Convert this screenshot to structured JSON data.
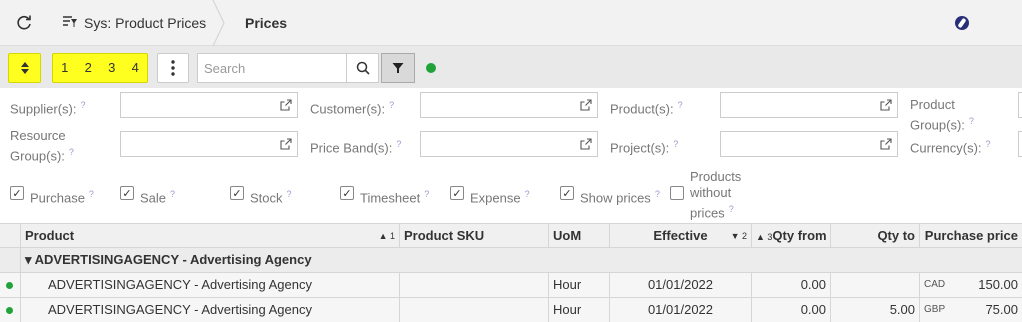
{
  "header": {
    "crumb1": "Sys: Product Prices",
    "crumb2": "Prices"
  },
  "toolbar": {
    "sort_numbers": [
      "1",
      "2",
      "3",
      "4"
    ],
    "search_placeholder": "Search"
  },
  "filters": {
    "supplier": "Supplier(s):",
    "customer": "Customer(s):",
    "product": "Product(s):",
    "product_group": "Product Group(s):",
    "resource_group_1": "Resource",
    "resource_group_2": "Group(s):",
    "price_band": "Price Band(s):",
    "project": "Project(s):",
    "currency": "Currency(s):",
    "help": "?"
  },
  "checkboxes": {
    "purchase": "Purchase",
    "sale": "Sale",
    "stock": "Stock",
    "timesheet": "Timesheet",
    "expense": "Expense",
    "show_prices": "Show prices",
    "products_without_1": "Products",
    "products_without_2": "without",
    "products_without_3": "prices"
  },
  "grid": {
    "columns": {
      "product": "Product",
      "product_sort": "▲ 1",
      "sku": "Product SKU",
      "uom": "UoM",
      "effective": "Effective",
      "effective_sort": "▼ 2",
      "qty_from_sort": "▲ 3",
      "qty_from": "Qty from",
      "qty_to": "Qty to",
      "purchase_price": "Purchase price"
    },
    "group_row": "▾ ADVERTISINGAGENCY - Advertising Agency",
    "rows": [
      {
        "product": "ADVERTISINGAGENCY - Advertising Agency",
        "sku": "",
        "uom": "Hour",
        "effective": "01/01/2022",
        "qty_from": "0.00",
        "qty_to": "",
        "currency": "CAD",
        "price": "150.00"
      },
      {
        "product": "ADVERTISINGAGENCY - Advertising Agency",
        "sku": "",
        "uom": "Hour",
        "effective": "01/01/2022",
        "qty_from": "0.00",
        "qty_to": "5.00",
        "currency": "GBP",
        "price": "75.00"
      }
    ]
  },
  "colors": {
    "highlight": "#ffff1f",
    "status_green": "#22a33a"
  }
}
